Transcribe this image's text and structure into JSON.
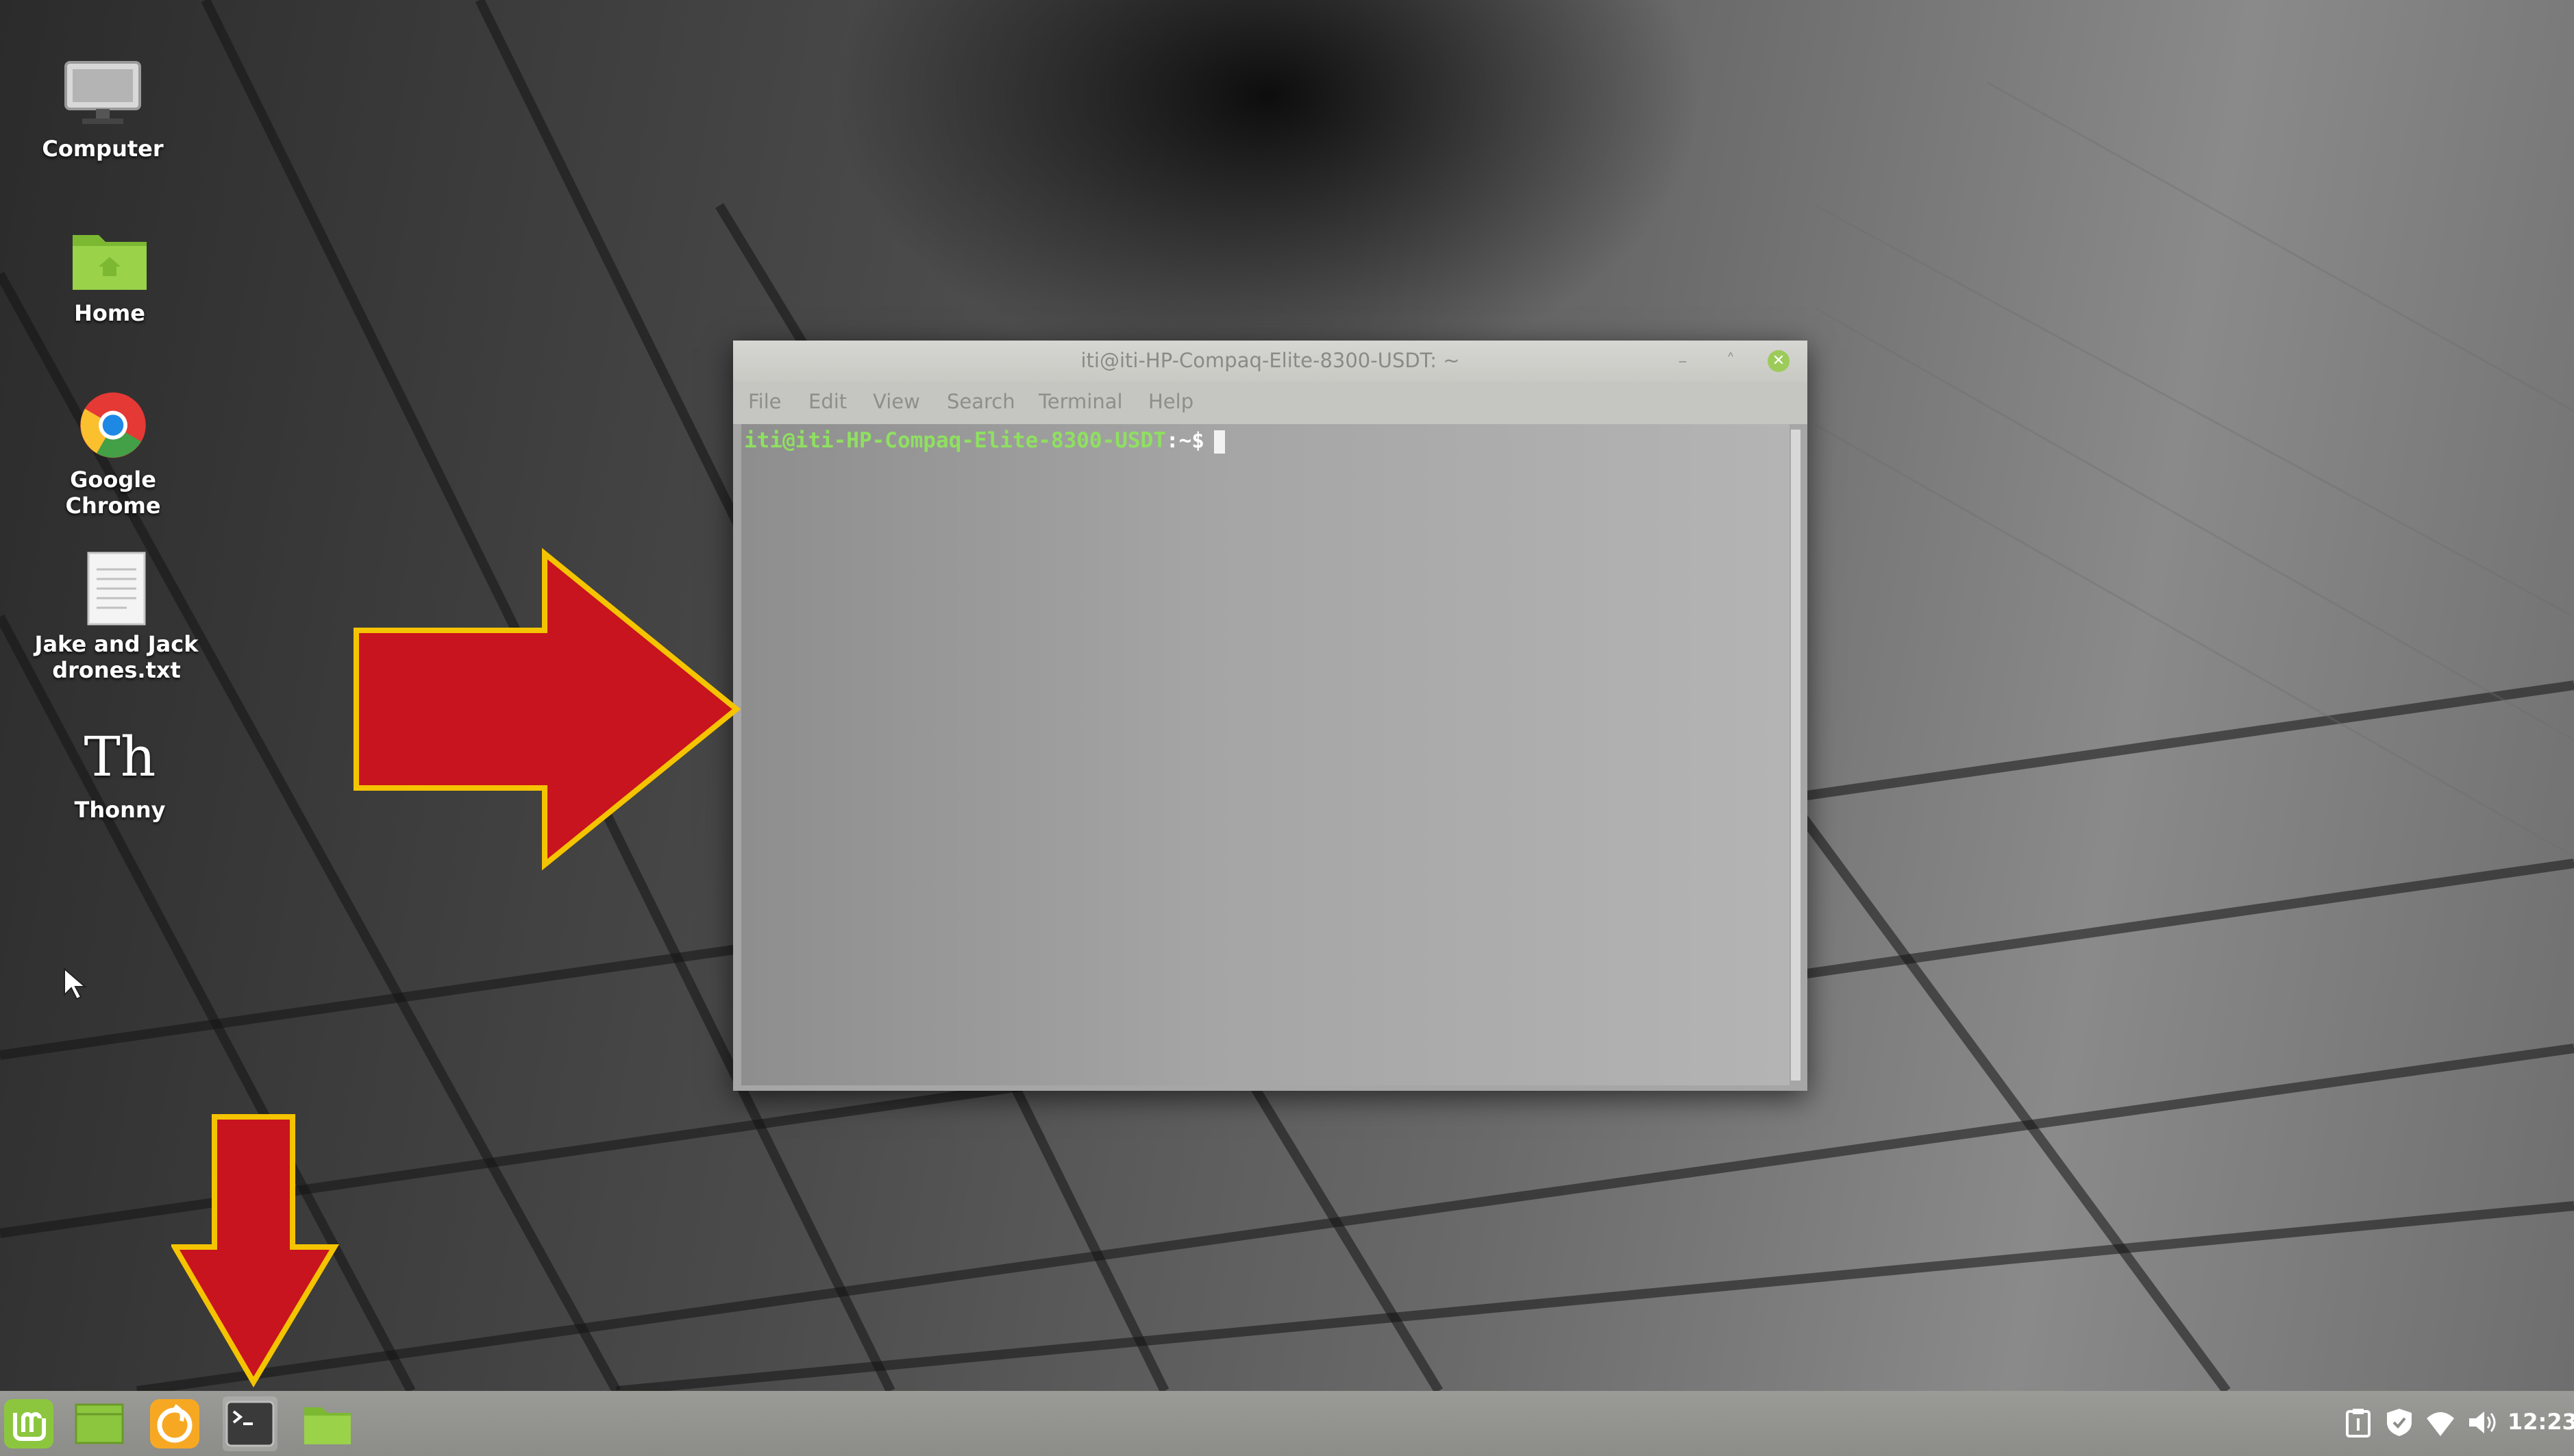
{
  "desktop": {
    "icons": [
      {
        "label": "Computer",
        "icon": "computer-icon"
      },
      {
        "label": "Home",
        "icon": "home-folder-icon"
      },
      {
        "label": "Google Chrome",
        "icon": "chrome-icon"
      },
      {
        "label": "Jake and Jack drones.txt",
        "icon": "text-file-icon"
      },
      {
        "label": "Thonny",
        "icon": "thonny-icon"
      }
    ],
    "thonny_glyph": "Th"
  },
  "terminal": {
    "title": "iti@iti-HP-Compaq-Elite-8300-USDT: ~",
    "menu": [
      "File",
      "Edit",
      "View",
      "Search",
      "Terminal",
      "Help"
    ],
    "prompt_user_host": "iti@iti-HP-Compaq-Elite-8300-USDT",
    "prompt_tail": ":~$",
    "controls": {
      "minimize": "–",
      "maximize": "˄",
      "close": "✕"
    }
  },
  "annotations": {
    "arrow_color": "#c8141e",
    "arrow_outline": "#f5c400",
    "targets": [
      "terminal-window",
      "taskbar-terminal-button"
    ]
  },
  "taskbar": {
    "items": [
      "mint-menu-icon",
      "show-desktop-icon",
      "firefox-icon",
      "terminal-icon",
      "files-icon"
    ],
    "tray": [
      "clipboard-icon",
      "shield-icon",
      "wifi-icon",
      "volume-icon"
    ],
    "clock": "12:23"
  },
  "colors": {
    "mint_green": "#8cc63f",
    "prompt_green": "#8fe060"
  }
}
